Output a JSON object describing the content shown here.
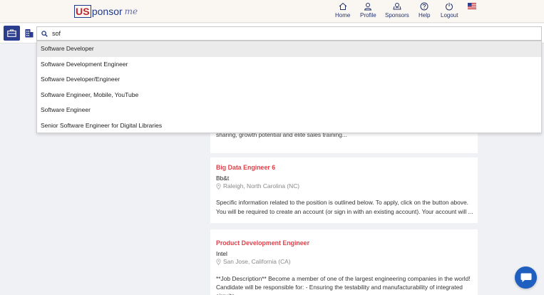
{
  "logo": {
    "us": "US",
    "ponsor": "ponsor",
    "me": "me"
  },
  "nav": [
    {
      "label": "Home",
      "icon": "home-icon"
    },
    {
      "label": "Profile",
      "icon": "user-icon"
    },
    {
      "label": "Sponsors",
      "icon": "sponsors-icon"
    },
    {
      "label": "Help",
      "icon": "help-icon"
    },
    {
      "label": "Logout",
      "icon": "logout-icon"
    }
  ],
  "search": {
    "value": "sof"
  },
  "suggestions": [
    "Software Developer",
    "Software Development Engineer",
    "Software Developer/Engineer",
    "Software Engineer, Mobile, YouTube",
    "Software Engineer",
    "Senior Software Engineer for Digital Libraries"
  ],
  "partial_card": {
    "desc": "sharing, growth potential and elite sales training..."
  },
  "jobs": [
    {
      "title": "Big Data Engineer 6",
      "company": "Bb&t",
      "location": "Raleigh, North Carolina (NC)",
      "desc1": "Specific information related to the position is outlined below. To apply, click on the button above.",
      "desc2": "You will be required to create an account (or sign in with an existing account). Your account will ..."
    },
    {
      "title": "Product Development Engineer",
      "company": "Intel",
      "location": "San Jose, California (CA)",
      "desc1": "**Job Description** Become a member of one of the largest engineering companies in the world!",
      "desc2": "Candidate will be responsible for: - Ensuring the testability and manufacturability of integrated",
      "desc3": "circuits"
    }
  ],
  "colors": {
    "brand_blue": "#2a3d8f",
    "title_red": "#e0414b",
    "chat_blue": "#1e5fbf"
  }
}
